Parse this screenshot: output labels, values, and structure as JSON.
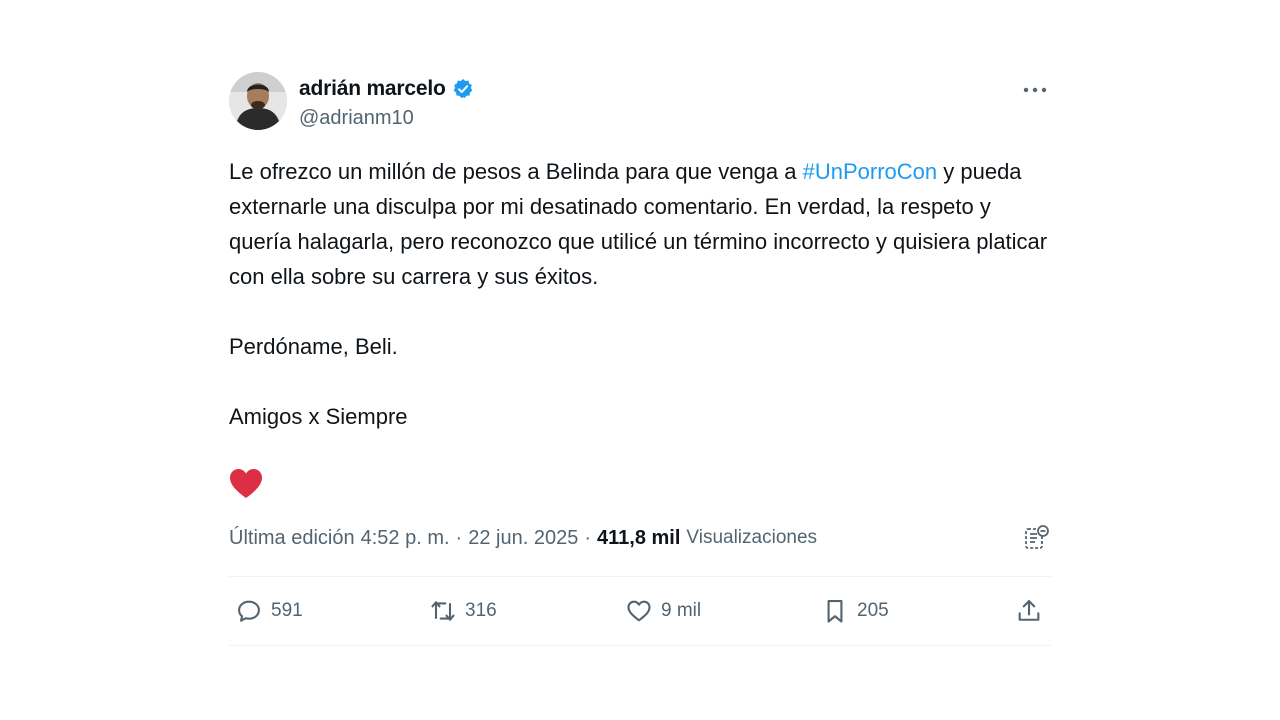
{
  "author": {
    "display_name": "adrián marcelo",
    "handle": "@adrianm10",
    "verified": true
  },
  "tweet": {
    "text_before_hashtag": "Le ofrezco un millón de pesos a Belinda para que venga a ",
    "hashtag": "#UnPorroCon",
    "text_after_hashtag": " y pueda externarle una disculpa por mi desatinado comentario. En verdad, la respeto y quería halagarla, pero reconozco que utilicé un término incorrecto y quisiera platicar con ella sobre su carrera y sus éxitos.",
    "paragraph_2": "Perdóname, Beli.",
    "paragraph_3": "Amigos x Siempre",
    "emoji": "red-heart"
  },
  "meta": {
    "edited_label": "Última edición",
    "time": "4:52 p. m.",
    "separator": "·",
    "date": "22 jun. 2025",
    "views_count": "411,8 mil",
    "views_label": "Visualizaciones"
  },
  "actions": {
    "replies": "591",
    "reposts": "316",
    "likes": "9 mil",
    "bookmarks": "205"
  },
  "colors": {
    "accent": "#1d9bf0",
    "text": "#0f1419",
    "secondary": "#536471",
    "heart": "#e0245e"
  }
}
